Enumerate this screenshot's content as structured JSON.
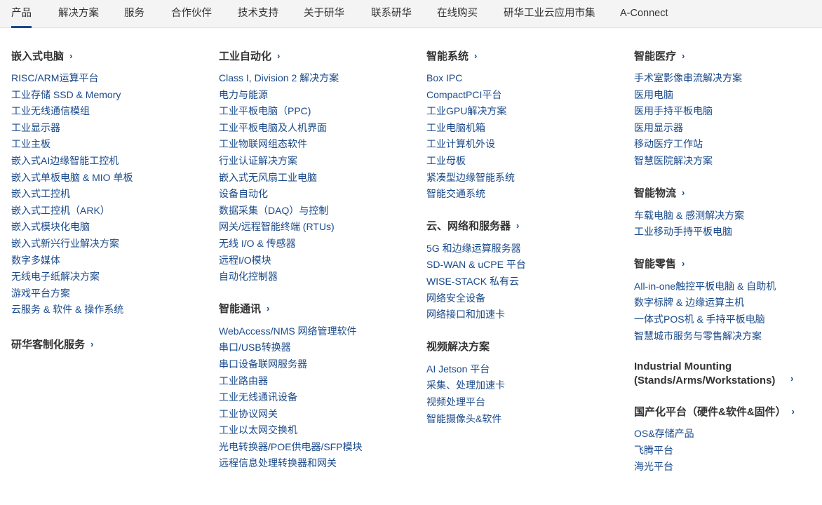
{
  "nav": {
    "tabs": [
      {
        "label": "产品",
        "active": true
      },
      {
        "label": "解决方案"
      },
      {
        "label": "服务"
      },
      {
        "label": "合作伙伴"
      },
      {
        "label": "技术支持"
      },
      {
        "label": "关于研华"
      },
      {
        "label": "联系研华"
      },
      {
        "label": "在线购买"
      },
      {
        "label": "研华工业云应用市集"
      },
      {
        "label": "A-Connect"
      }
    ],
    "accent_color": "#1a4a8a"
  },
  "columns": [
    {
      "groups": [
        {
          "title": "嵌入式电脑",
          "links": [
            "RISC/ARM运算平台",
            "工业存储 SSD & Memory",
            "工业无线通信模组",
            "工业显示器",
            "工业主板",
            "嵌入式AI边缘智能工控机",
            "嵌入式单板电脑 & MIO 单板",
            "嵌入式工控机",
            "嵌入式工控机（ARK）",
            "嵌入式模块化电脑",
            "嵌入式新兴行业解决方案",
            "数字多媒体",
            "无线电子纸解决方案",
            "游戏平台方案",
            "云服务 & 软件 & 操作系统"
          ]
        },
        {
          "title": "研华客制化服务",
          "links": []
        }
      ]
    },
    {
      "groups": [
        {
          "title": "工业自动化",
          "links": [
            "Class I, Division 2 解决方案",
            "电力与能源",
            "工业平板电脑（PPC)",
            "工业平板电脑及人机界面",
            "工业物联网组态软件",
            "行业认证解决方案",
            "嵌入式无风扇工业电脑",
            "设备自动化",
            "数据采集（DAQ）与控制",
            "网关/远程智能终端 (RTUs)",
            "无线 I/O & 传感器",
            "远程I/O模块",
            "自动化控制器"
          ]
        },
        {
          "title": "智能通讯",
          "links": [
            "WebAccess/NMS 网络管理软件",
            "串口/USB转换器",
            "串口设备联网服务器",
            "工业路由器",
            "工业无线通讯设备",
            "工业协议网关",
            "工业以太网交换机",
            "光电转换器/POE供电器/SFP模块",
            "远程信息处理转换器和网关"
          ]
        }
      ]
    },
    {
      "groups": [
        {
          "title": "智能系统",
          "links": [
            "Box IPC",
            "CompactPCI平台",
            "工业GPU解决方案",
            "工业电脑机箱",
            "工业计算机外设",
            "工业母板",
            "紧凑型边缘智能系统",
            "智能交通系统"
          ]
        },
        {
          "title": "云、网络和服务器",
          "links": [
            "5G 和边缘运算服务器",
            "SD-WAN & uCPE 平台",
            "WISE-STACK 私有云",
            "网络安全设备",
            "网络接口和加速卡"
          ]
        },
        {
          "title": "视频解决方案",
          "links": [
            "AI Jetson 平台",
            "采集、处理加速卡",
            "视频处理平台",
            "智能摄像头&软件"
          ]
        }
      ]
    },
    {
      "groups": [
        {
          "title": "智能医疗",
          "links": [
            "手术室影像串流解决方案",
            "医用电脑",
            "医用手持平板电脑",
            "医用显示器",
            "移动医疗工作站",
            "智慧医院解决方案"
          ]
        },
        {
          "title": "智能物流",
          "links": [
            "车载电脑 & 感测解决方案",
            "工业移动手持平板电脑"
          ]
        },
        {
          "title": "智能零售",
          "links": [
            "All-in-one触控平板电脑 & 自助机",
            "数字标牌 & 边缘运算主机",
            "一体式POS机 & 手持平板电脑",
            "智慧城市服务与零售解决方案"
          ]
        },
        {
          "title": "Industrial Mounting (Stands/Arms/Workstations)",
          "links": []
        },
        {
          "title": "国产化平台（硬件&软件&固件）",
          "links": [
            "OS&存储产品",
            "飞腾平台",
            "海光平台"
          ]
        }
      ]
    }
  ]
}
